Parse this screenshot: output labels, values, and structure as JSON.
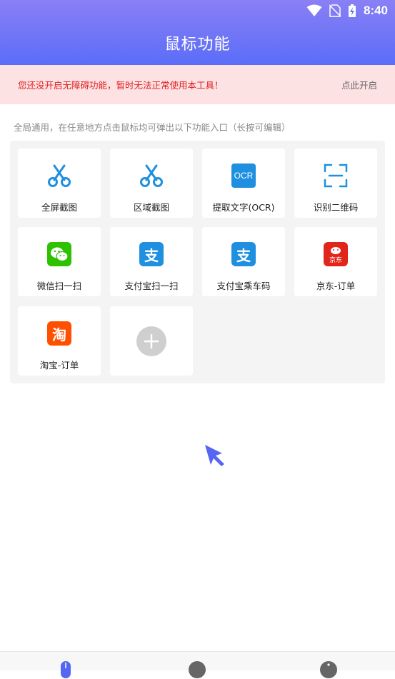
{
  "status_bar": {
    "time": "8:40"
  },
  "header": {
    "title": "鼠标功能"
  },
  "warning": {
    "message": "您还没开启无障碍功能，暂时无法正常使用本工具！",
    "action": "点此开启"
  },
  "hint": "全局通用，在任意地方点击鼠标均可弹出以下功能入口（长按可编辑）",
  "tiles": [
    {
      "label": "全屏截图",
      "icon": "scissors-icon"
    },
    {
      "label": "区域截图",
      "icon": "scissors-icon"
    },
    {
      "label": "提取文字(OCR)",
      "icon": "ocr-icon",
      "badge_text": "OCR"
    },
    {
      "label": "识别二维码",
      "icon": "scan-qr-icon"
    },
    {
      "label": "微信扫一扫",
      "icon": "wechat-icon"
    },
    {
      "label": "支付宝扫一扫",
      "icon": "alipay-icon",
      "badge_text": "支"
    },
    {
      "label": "支付宝乘车码",
      "icon": "alipay-icon",
      "badge_text": "支"
    },
    {
      "label": "京东-订单",
      "icon": "jd-icon",
      "badge_text": "京东"
    },
    {
      "label": "淘宝-订单",
      "icon": "taobao-icon",
      "badge_text": "淘"
    }
  ],
  "colors": {
    "header_gradient_top": "#8a7ff5",
    "header_gradient_bottom": "#5a6df8",
    "warning_bg": "#fde2e4",
    "warning_text": "#e0201f",
    "icon_blue": "#1f8fe0",
    "wechat_green": "#2dc100",
    "jd_red": "#e1251b",
    "taobao_orange": "#ff5000",
    "cursor": "#5566f2"
  }
}
